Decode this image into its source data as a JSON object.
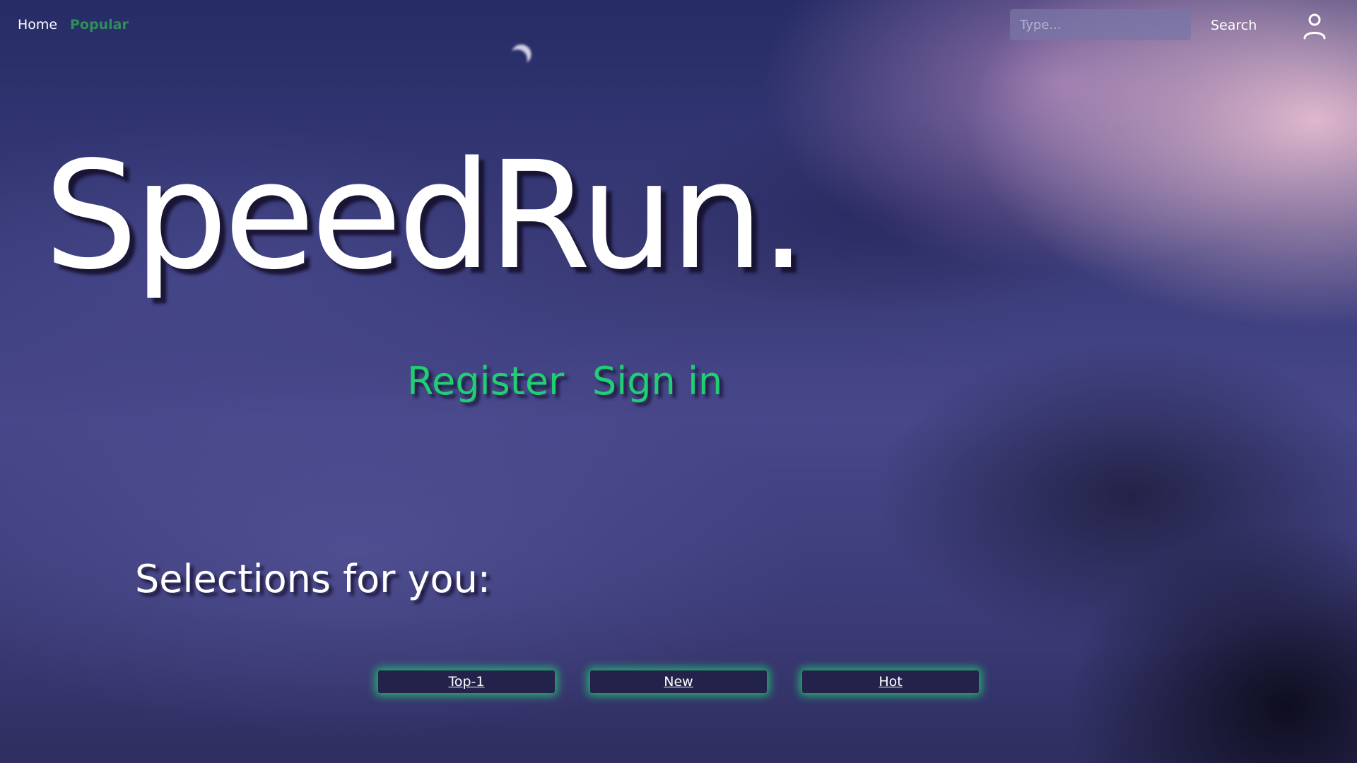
{
  "nav": {
    "home": "Home",
    "popular": "Popular"
  },
  "search": {
    "placeholder": "Type...",
    "button_label": "Search"
  },
  "user_icon": "user-icon",
  "hero": {
    "title": "SpeedRun."
  },
  "auth": {
    "register": "Register",
    "sign_in": "Sign in"
  },
  "selections": {
    "heading": "Selections for you:",
    "buttons": [
      "Top-1",
      "New",
      "Hot"
    ]
  },
  "colors": {
    "accent": "#1fcf72",
    "popular_link": "#2f8f5a",
    "button_bg": "#22224a"
  }
}
